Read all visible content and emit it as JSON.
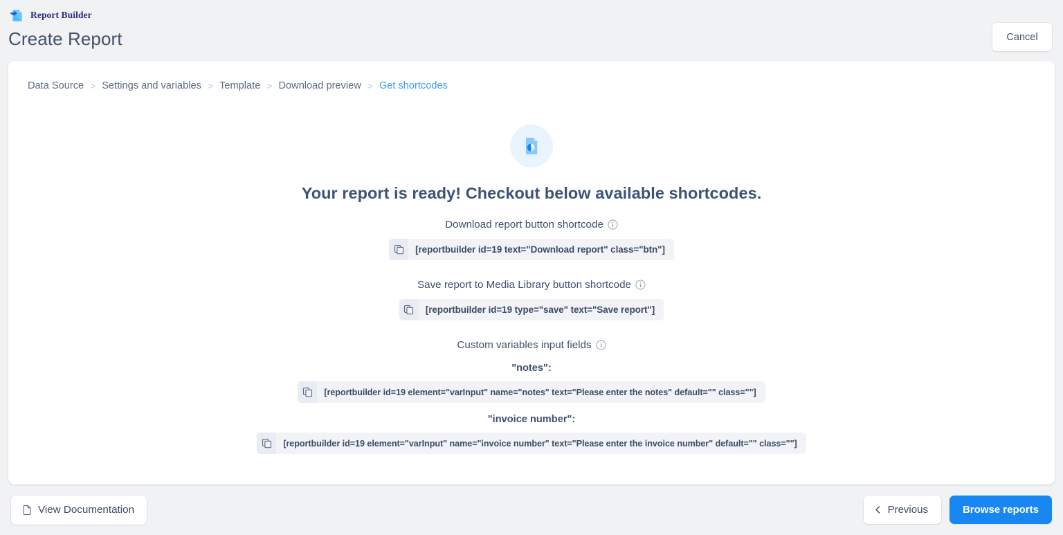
{
  "brand": {
    "name": "Report Builder",
    "logo_icon": "report-document-icon"
  },
  "header": {
    "title": "Create Report",
    "cancel_label": "Cancel"
  },
  "breadcrumb": {
    "separator": ">",
    "items": [
      {
        "label": "Data Source",
        "active": false
      },
      {
        "label": "Settings and variables",
        "active": false
      },
      {
        "label": "Template",
        "active": false
      },
      {
        "label": "Download preview",
        "active": false
      },
      {
        "label": "Get shortcodes",
        "active": true
      }
    ]
  },
  "hero": {
    "icon": "document-pie-chart-icon",
    "title": "Your report is ready! Checkout below available shortcodes."
  },
  "sections": [
    {
      "label": "Download report button shortcode",
      "info_icon": "info-circle-icon",
      "copy_icon": "copy-icon",
      "code": "[reportbuilder id=19 text=\"Download report\" class=\"btn\"]"
    },
    {
      "label": "Save report to Media Library button shortcode",
      "info_icon": "info-circle-icon",
      "copy_icon": "copy-icon",
      "code": "[reportbuilder id=19 type=\"save\" text=\"Save report\"]"
    }
  ],
  "custom_variables": {
    "label": "Custom variables input fields",
    "info_icon": "info-circle-icon",
    "fields": [
      {
        "name": "\"notes\":",
        "copy_icon": "copy-icon",
        "code": "[reportbuilder id=19 element=\"varInput\" name=\"notes\" text=\"Please enter the notes\" default=\"\" class=\"\"]"
      },
      {
        "name": "\"invoice number\":",
        "copy_icon": "copy-icon",
        "code": "[reportbuilder id=19 element=\"varInput\" name=\"invoice number\" text=\"Please enter the invoice number\" default=\"\" class=\"\"]"
      }
    ]
  },
  "footer": {
    "docs_label": "View Documentation",
    "docs_icon": "file-icon",
    "previous_label": "Previous",
    "previous_icon": "chevron-left-icon",
    "browse_label": "Browse reports"
  },
  "colors": {
    "page_background": "#f1f2f4",
    "card_background": "#ffffff",
    "accent": "#1887f2",
    "link": "#3c9cf5",
    "text": "#3b4a66",
    "brand_text": "#2a2d7c",
    "code_pill_background": "#f1f3f7",
    "copy_cell_background": "#e9ecf2",
    "hero_badge_background": "#eaf4fe"
  }
}
